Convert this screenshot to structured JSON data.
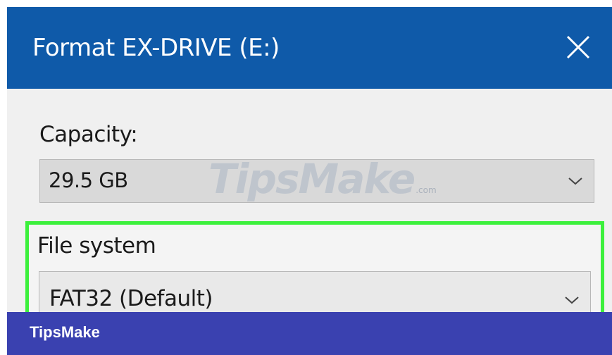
{
  "dialog": {
    "title": "Format EX-DRIVE (E:)",
    "close_icon": "close-icon"
  },
  "capacity": {
    "label": "Capacity:",
    "value": "29.5 GB",
    "arrow_icon": "chevron-down-icon"
  },
  "file_system": {
    "label": "File system",
    "value": "FAT32 (Default)",
    "arrow_icon": "chevron-down-icon",
    "highlight_color": "#3cf03c"
  },
  "watermark": {
    "brand": "TipsMake",
    "suffix": ".com"
  },
  "footer": {
    "brand": "TipsMake"
  },
  "colors": {
    "titlebar": "#0f5aa9",
    "footer_band": "#3a41b0",
    "client": "#f0f0f0"
  }
}
